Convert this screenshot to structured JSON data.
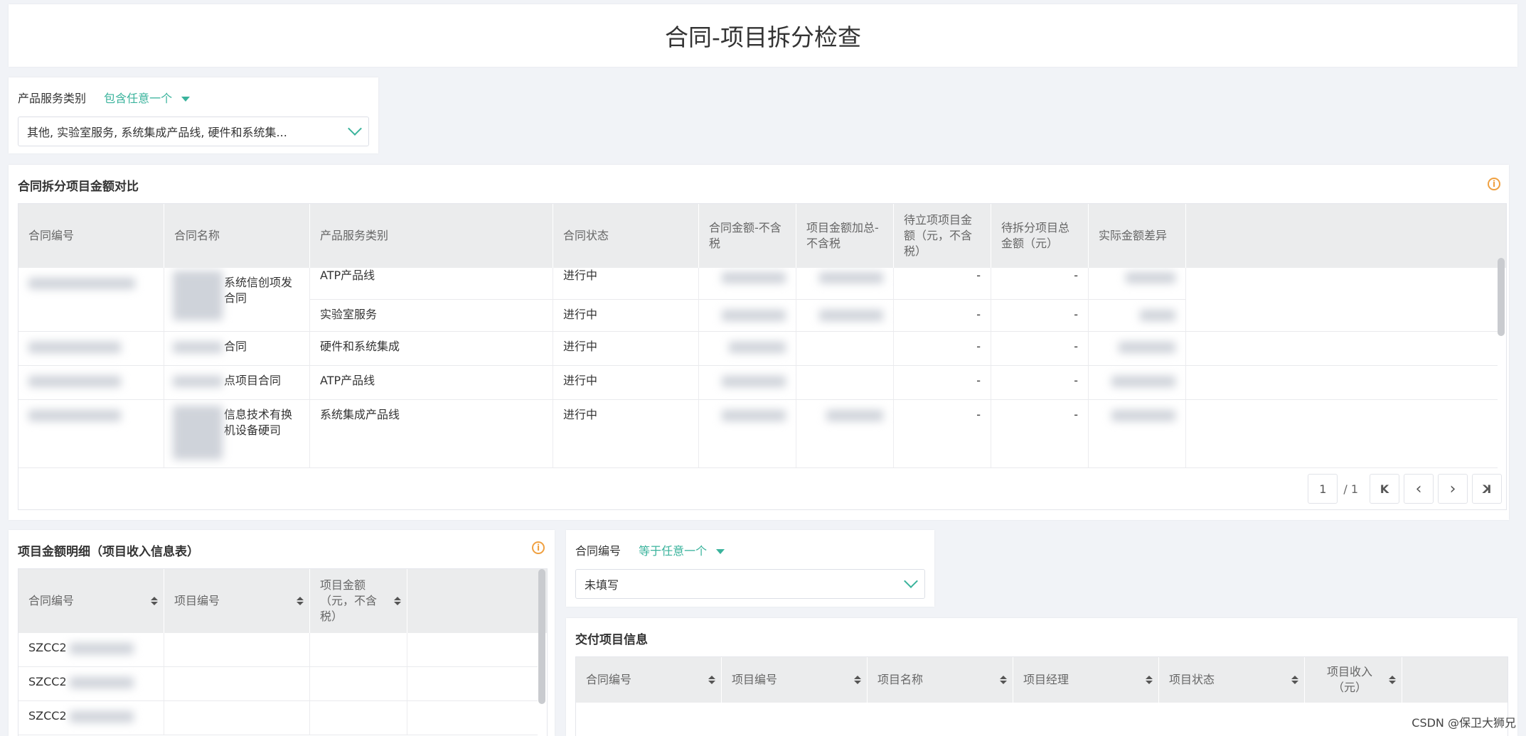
{
  "page": {
    "title": "合同-项目拆分检查",
    "watermark": "CSDN @保卫大狮兄"
  },
  "filter_category": {
    "label": "产品服务类别",
    "mode": "包含任意一个",
    "value": "其他, 实验室服务, 系统集成产品线, 硬件和系统集..."
  },
  "compare": {
    "title": "合同拆分项目金额对比",
    "columns": [
      "合同编号",
      "合同名称",
      "产品服务类别",
      "合同状态",
      "合同金额-不含税",
      "项目金额加总-不含税",
      "待立项项目金额（元，不含税）",
      "待拆分项目总金额（元）",
      "实际金额差异"
    ],
    "rows": [
      {
        "name": "系统信创项发合同",
        "category": "ATP产品线",
        "status": "进行中",
        "pending": "-",
        "split": "-"
      },
      {
        "name": "",
        "category": "实验室服务",
        "status": "进行中",
        "pending": "-",
        "split": "-"
      },
      {
        "name": "合同",
        "category": "硬件和系统集成",
        "status": "进行中",
        "pending": "-",
        "split": "-"
      },
      {
        "name": "点项目合同",
        "category": "ATP产品线",
        "status": "进行中",
        "pending": "-",
        "split": "-"
      },
      {
        "name": "信息技术有换机设备硬司",
        "category": "系统集成产品线",
        "status": "进行中",
        "pending": "-",
        "split": "-"
      }
    ],
    "pager": {
      "page": "1",
      "total": "/ 1",
      "first": "K",
      "prev": "‹",
      "next": "›",
      "last": "K"
    }
  },
  "detail": {
    "title": "项目金额明细（项目收入信息表）",
    "columns": [
      "合同编号",
      "项目编号",
      "项目金额（元，不含税）"
    ],
    "rows": [
      {
        "contract": "SZCC2"
      },
      {
        "contract": "SZCC2"
      },
      {
        "contract": "SZCC2"
      }
    ]
  },
  "filter_contract": {
    "label": "合同编号",
    "mode": "等于任意一个",
    "value": "未填写"
  },
  "delivery": {
    "title": "交付项目信息",
    "columns": [
      "合同编号",
      "项目编号",
      "项目名称",
      "项目经理",
      "项目状态",
      "项目收入（元）"
    ]
  }
}
